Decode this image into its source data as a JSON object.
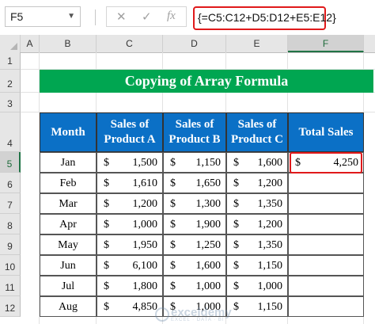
{
  "formula_bar": {
    "name_box": "F5",
    "cancel_icon": "✕",
    "enter_icon": "✓",
    "fx_label": "fx",
    "formula": "{=C5:C12+D5:D12+E5:E12}"
  },
  "columns": [
    "A",
    "B",
    "C",
    "D",
    "E",
    "F"
  ],
  "rows": [
    "1",
    "2",
    "3",
    "4",
    "5",
    "6",
    "7",
    "8",
    "9",
    "10",
    "11",
    "12"
  ],
  "title": "Copying of Array Formula",
  "table": {
    "headers": [
      "Month",
      "Sales of Product A",
      "Sales of Product B",
      "Sales of Product C",
      "Total Sales"
    ],
    "currency": "$",
    "rows": [
      {
        "month": "Jan",
        "a": "1,500",
        "b": "1,150",
        "c": "1,600",
        "total": "4,250"
      },
      {
        "month": "Feb",
        "a": "1,610",
        "b": "1,650",
        "c": "1,200",
        "total": ""
      },
      {
        "month": "Mar",
        "a": "1,200",
        "b": "1,300",
        "c": "1,350",
        "total": ""
      },
      {
        "month": "Apr",
        "a": "1,000",
        "b": "1,900",
        "c": "1,200",
        "total": ""
      },
      {
        "month": "May",
        "a": "1,950",
        "b": "1,250",
        "c": "1,350",
        "total": ""
      },
      {
        "month": "Jun",
        "a": "6,100",
        "b": "1,600",
        "c": "1,150",
        "total": ""
      },
      {
        "month": "Jul",
        "a": "1,800",
        "b": "1,000",
        "c": "1,000",
        "total": ""
      },
      {
        "month": "Aug",
        "a": "4,850",
        "b": "1,000",
        "c": "1,150",
        "total": ""
      }
    ]
  },
  "watermark": {
    "name": "exceldemy",
    "tagline": "EXCEL · DATA · BI"
  },
  "colors": {
    "title_bg": "#00a651",
    "header_bg": "#0b70c6",
    "highlight": "#e0191b"
  }
}
